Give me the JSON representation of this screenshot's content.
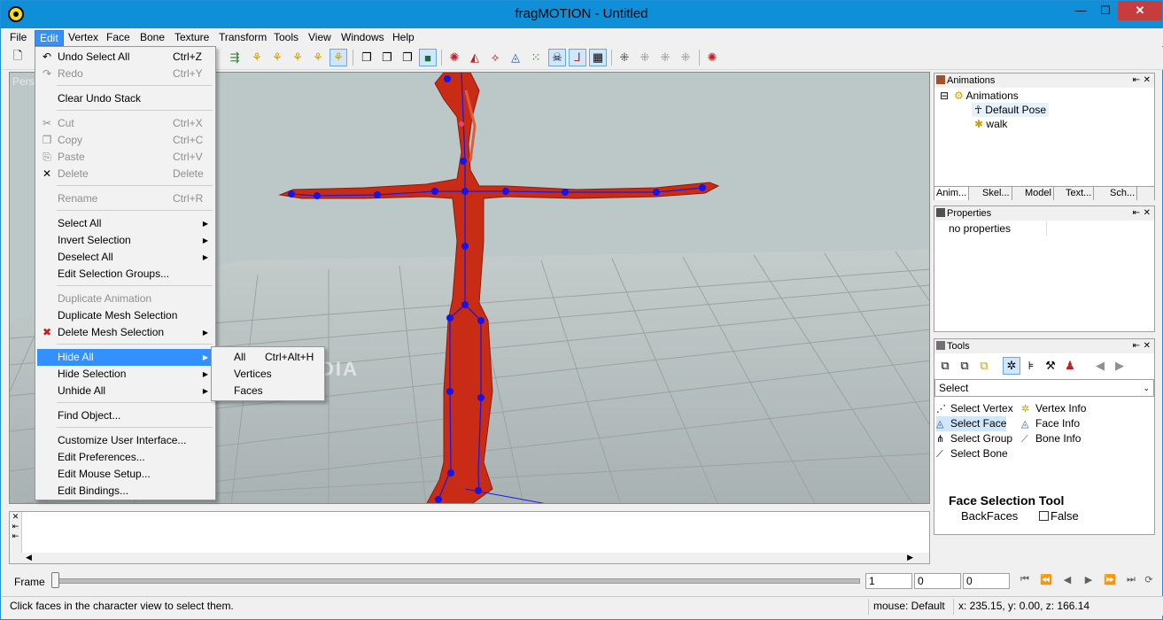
{
  "window": {
    "title": "fragMOTION - Untitled",
    "min_glyph": "—",
    "max_glyph": "☐",
    "close_glyph": "✕"
  },
  "menubar": {
    "items": [
      "File",
      "Edit",
      "Vertex",
      "Face",
      "Bone",
      "Texture",
      "Transform",
      "Tools",
      "View",
      "Windows",
      "Help"
    ],
    "active": "Edit"
  },
  "viewport": {
    "label": "Pers",
    "watermark": "SOFTPEDIA"
  },
  "edit_menu": {
    "items": [
      {
        "label": "Undo Select All",
        "shortcut": "Ctrl+Z",
        "icon": "undo-icon",
        "glyph": "↶",
        "disabled": false
      },
      {
        "label": "Redo",
        "shortcut": "Ctrl+Y",
        "icon": "redo-icon",
        "glyph": "↷",
        "disabled": true
      },
      {
        "label": "Clear Undo Stack",
        "shortcut": "",
        "disabled": false
      },
      {
        "label": "Cut",
        "shortcut": "Ctrl+X",
        "icon": "scissors-icon",
        "glyph": "✂",
        "disabled": true
      },
      {
        "label": "Copy",
        "shortcut": "Ctrl+C",
        "icon": "copy-icon",
        "glyph": "❐",
        "disabled": true
      },
      {
        "label": "Paste",
        "shortcut": "Ctrl+V",
        "icon": "paste-icon",
        "glyph": "⎘",
        "disabled": true
      },
      {
        "label": "Delete",
        "shortcut": "Delete",
        "icon": "delete-icon",
        "glyph": "✕",
        "disabled": true
      },
      {
        "label": "Rename",
        "shortcut": "Ctrl+R",
        "disabled": true
      },
      {
        "label": "Select All",
        "submenu": true
      },
      {
        "label": "Invert Selection",
        "submenu": true
      },
      {
        "label": "Deselect All",
        "submenu": true
      },
      {
        "label": "Edit Selection Groups...",
        "disabled": false
      },
      {
        "label": "Duplicate Animation",
        "disabled": true
      },
      {
        "label": "Duplicate Mesh Selection",
        "disabled": false
      },
      {
        "label": "Delete Mesh Selection",
        "submenu": true,
        "icon": "red-x-icon",
        "glyph": "✖"
      },
      {
        "label": "Hide All",
        "submenu": true,
        "highlighted": true
      },
      {
        "label": "Hide Selection",
        "submenu": true
      },
      {
        "label": "Unhide All",
        "submenu": true
      },
      {
        "label": "Find Object..."
      },
      {
        "label": "Customize User Interface..."
      },
      {
        "label": "Edit Preferences..."
      },
      {
        "label": "Edit Mouse Setup..."
      },
      {
        "label": "Edit Bindings..."
      }
    ]
  },
  "hide_submenu": {
    "items": [
      {
        "label": "All",
        "shortcut": "Ctrl+Alt+H"
      },
      {
        "label": "Vertices",
        "shortcut": ""
      },
      {
        "label": "Faces",
        "shortcut": ""
      }
    ]
  },
  "animations_panel": {
    "title": "Animations",
    "pin_glyph": "⇤",
    "close_glyph": "✕",
    "tree": {
      "root": "Animations",
      "expander": "⊟",
      "children": [
        "Default Pose",
        "walk"
      ],
      "selected": "Default Pose"
    },
    "tabs": [
      "Anim...",
      "Skel...",
      "Model",
      "Text...",
      "Sch..."
    ]
  },
  "properties_panel": {
    "title": "Properties",
    "empty_text": "no properties"
  },
  "tools_panel": {
    "title": "Tools",
    "select_value": "Select",
    "dropdown_glyph": "⌄",
    "items_left": [
      "Select Vertex",
      "Select Face",
      "Select Group",
      "Select Bone"
    ],
    "items_right": [
      "Vertex Info",
      "Face Info",
      "Bone Info"
    ],
    "selected_tool": "Select Face",
    "section_title": "Face Selection Tool",
    "property_label": "BackFaces",
    "property_value": "False"
  },
  "framebar": {
    "label": "Frame",
    "start": "1",
    "current": "0",
    "end": "0"
  },
  "statusbar": {
    "hint": "Click faces in the character view to select them.",
    "mouse_mode": "mouse: Default",
    "coords": "x: 235.15, y: 0.00, z: 166.14"
  }
}
